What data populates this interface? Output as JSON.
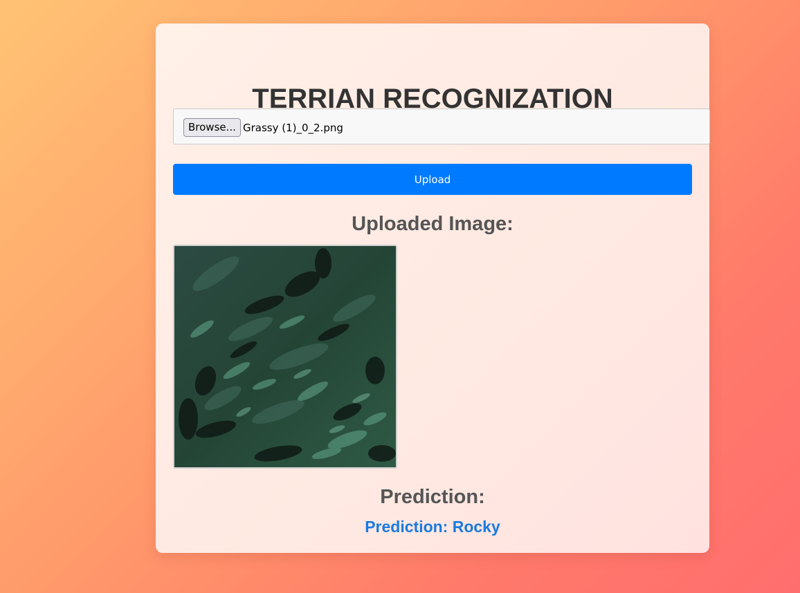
{
  "page": {
    "title": "TERRIAN RECOGNIZATION"
  },
  "file_input": {
    "browse_label": "Browse...",
    "file_name": "Grassy (1)_0_2.png"
  },
  "upload_button": {
    "label": "Upload"
  },
  "uploaded_section": {
    "heading": "Uploaded Image:",
    "image_description": "grassy terrain texture"
  },
  "prediction_section": {
    "heading": "Prediction:",
    "result": "Prediction: Rocky"
  },
  "colors": {
    "accent": "#007bff",
    "prediction_text": "#1a7ae0",
    "title_text": "#333333",
    "heading_text": "#555555"
  }
}
